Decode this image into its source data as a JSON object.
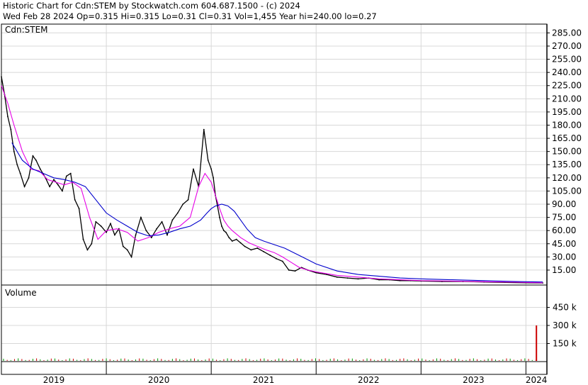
{
  "header": {
    "line1": "Historic Chart for Cdn:STEM by Stockwatch.com 604.687.1500 - (c) 2024",
    "line2": "Wed Feb 28 2024   Op=0.315   Hi=0.315   Lo=0.31   Cl=0.31   Vol=1,455   Year hi=240.00   lo=0.27"
  },
  "price_panel": {
    "label": "Cdn:STEM"
  },
  "volume_panel": {
    "label": "Volume"
  },
  "chart_data": {
    "type": "line",
    "x_labels": [
      "2019",
      "2020",
      "2021",
      "2022",
      "2023",
      "2024"
    ],
    "price_axis": {
      "ticks": [
        "285.00",
        "270.00",
        "255.00",
        "240.00",
        "225.00",
        "210.00",
        "195.00",
        "180.00",
        "165.00",
        "150.00",
        "135.00",
        "120.00",
        "105.00",
        "90.00",
        "75.00",
        "60.00",
        "45.00",
        "30.00",
        "15.00"
      ],
      "ylim": [
        -2,
        295
      ]
    },
    "volume_axis": {
      "ticks": [
        "450 k",
        "300 k",
        "150 k"
      ],
      "ylim": [
        0,
        600
      ]
    },
    "grid": true,
    "colors": {
      "price": "#000000",
      "ma_short": "#e600e6",
      "ma_long": "#0000cc",
      "volume_spike": "#cc0000",
      "volume_up": "#009900",
      "volume_down": "#cc0000"
    },
    "series": [
      {
        "kind": "price",
        "x": [
          2019.0,
          2019.03,
          2019.06,
          2019.09,
          2019.12,
          2019.15,
          2019.18,
          2019.22,
          2019.26,
          2019.3,
          2019.33,
          2019.37,
          2019.42,
          2019.46,
          2019.5,
          2019.54,
          2019.58,
          2019.62,
          2019.66,
          2019.7,
          2019.74,
          2019.78,
          2019.82,
          2019.86,
          2019.9,
          2019.95,
          2020.0,
          2020.04,
          2020.08,
          2020.12,
          2020.16,
          2020.2,
          2020.24,
          2020.28,
          2020.33,
          2020.38,
          2020.43,
          2020.48,
          2020.53,
          2020.58,
          2020.63,
          2020.68,
          2020.73,
          2020.78,
          2020.83,
          2020.88,
          2020.93,
          2020.97,
          2021.0,
          2021.02,
          2021.04,
          2021.06,
          2021.08,
          2021.1,
          2021.12,
          2021.14,
          2021.17,
          2021.2,
          2021.24,
          2021.28,
          2021.32,
          2021.38,
          2021.44,
          2021.5,
          2021.56,
          2021.62,
          2021.68,
          2021.74,
          2021.8,
          2021.86,
          2021.92,
          2022.0,
          2022.1,
          2022.2,
          2022.3,
          2022.4,
          2022.5,
          2022.6,
          2022.7,
          2022.8,
          2022.9,
          2023.0,
          2023.2,
          2023.4,
          2023.6,
          2023.8,
          2024.0,
          2024.16
        ],
        "y": [
          235,
          215,
          190,
          175,
          150,
          135,
          125,
          110,
          120,
          145,
          140,
          130,
          120,
          110,
          118,
          112,
          105,
          122,
          125,
          95,
          85,
          50,
          38,
          45,
          70,
          65,
          58,
          68,
          55,
          62,
          42,
          38,
          30,
          55,
          75,
          60,
          52,
          62,
          70,
          55,
          72,
          80,
          90,
          95,
          130,
          110,
          175,
          140,
          130,
          120,
          100,
          88,
          75,
          65,
          60,
          58,
          52,
          48,
          50,
          46,
          42,
          38,
          40,
          36,
          32,
          28,
          25,
          15,
          14,
          18,
          15,
          12,
          10,
          7,
          6,
          5,
          6,
          4,
          4,
          3,
          3,
          2.5,
          2,
          2,
          1.5,
          1,
          0.5,
          0.31
        ]
      },
      {
        "kind": "ma_short",
        "x": [
          2019.0,
          2019.06,
          2019.12,
          2019.2,
          2019.28,
          2019.36,
          2019.44,
          2019.52,
          2019.6,
          2019.68,
          2019.76,
          2019.84,
          2019.92,
          2020.0,
          2020.1,
          2020.2,
          2020.3,
          2020.4,
          2020.5,
          2020.6,
          2020.7,
          2020.8,
          2020.88,
          2020.94,
          2021.0,
          2021.04,
          2021.08,
          2021.12,
          2021.16,
          2021.2,
          2021.28,
          2021.36,
          2021.44,
          2021.52,
          2021.6,
          2021.68,
          2021.76,
          2021.84,
          2021.92,
          2022.0,
          2022.2,
          2022.4,
          2022.6,
          2022.8,
          2023.0,
          2023.3,
          2023.6,
          2023.9,
          2024.16
        ],
        "y": [
          225,
          205,
          180,
          150,
          130,
          128,
          118,
          115,
          112,
          115,
          108,
          75,
          50,
          60,
          62,
          58,
          48,
          52,
          58,
          62,
          65,
          75,
          110,
          125,
          115,
          100,
          85,
          72,
          65,
          60,
          52,
          46,
          42,
          38,
          35,
          30,
          24,
          18,
          15,
          13,
          9,
          7,
          5,
          4,
          3,
          2.5,
          1.8,
          1.2,
          0.5
        ]
      },
      {
        "kind": "ma_long",
        "x": [
          2019.1,
          2019.2,
          2019.3,
          2019.4,
          2019.5,
          2019.6,
          2019.7,
          2019.8,
          2019.9,
          2020.0,
          2020.1,
          2020.2,
          2020.3,
          2020.4,
          2020.5,
          2020.6,
          2020.7,
          2020.8,
          2020.9,
          2020.96,
          2021.0,
          2021.04,
          2021.1,
          2021.16,
          2021.22,
          2021.28,
          2021.34,
          2021.42,
          2021.5,
          2021.6,
          2021.7,
          2021.8,
          2021.9,
          2022.0,
          2022.2,
          2022.4,
          2022.6,
          2022.8,
          2023.0,
          2023.3,
          2023.6,
          2023.9,
          2024.16
        ],
        "y": [
          160,
          140,
          130,
          125,
          120,
          118,
          115,
          110,
          95,
          80,
          72,
          65,
          58,
          54,
          55,
          58,
          62,
          65,
          72,
          80,
          85,
          88,
          90,
          88,
          82,
          72,
          62,
          52,
          48,
          44,
          40,
          34,
          28,
          22,
          14,
          10,
          8,
          6,
          5,
          4,
          3,
          2,
          1.5
        ]
      }
    ],
    "volume_spike": {
      "x": 2024.1,
      "value": 300000
    }
  }
}
